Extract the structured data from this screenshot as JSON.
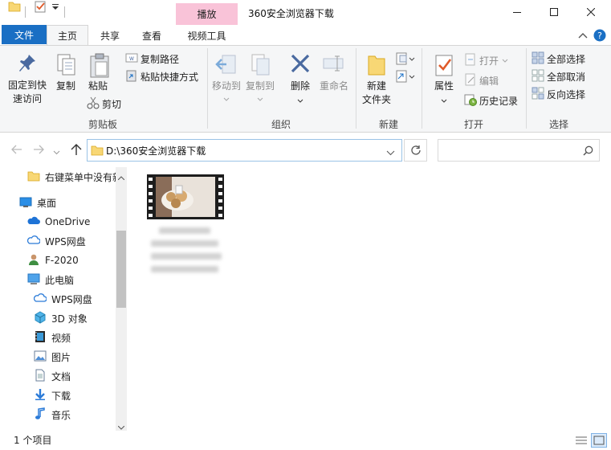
{
  "titlebar": {
    "context_tab": "播放",
    "title": "360安全浏览器下载"
  },
  "tabs": {
    "file": "文件",
    "home": "主页",
    "share": "共享",
    "view": "查看",
    "video_tools": "视频工具"
  },
  "ribbon": {
    "clipboard": {
      "group": "剪贴板",
      "pin": "固定到快速访问",
      "pin_line1": "固定到快",
      "pin_line2": "速访问",
      "copy": "复制",
      "paste": "粘贴",
      "copy_path": "复制路径",
      "paste_shortcut": "粘贴快捷方式",
      "cut": "剪切"
    },
    "organize": {
      "group": "组织",
      "move_to": "移动到",
      "copy_to": "复制到",
      "delete": "删除",
      "rename": "重命名"
    },
    "new": {
      "group": "新建",
      "new_folder_line1": "新建",
      "new_folder_line2": "文件夹"
    },
    "open": {
      "group": "打开",
      "properties": "属性",
      "open": "打开",
      "edit": "编辑",
      "history": "历史记录"
    },
    "select": {
      "group": "选择",
      "select_all": "全部选择",
      "select_none": "全部取消",
      "invert": "反向选择"
    }
  },
  "address": {
    "path": "D:\\360安全浏览器下载",
    "search_placeholder": ""
  },
  "nav": {
    "items": [
      {
        "label": "右键菜单中没有新",
        "icon": "folder-icon"
      },
      {
        "label": "桌面",
        "icon": "desktop-icon"
      },
      {
        "label": "OneDrive",
        "icon": "onedrive-icon"
      },
      {
        "label": "WPS网盘",
        "icon": "cloud-icon"
      },
      {
        "label": "F-2020",
        "icon": "user-icon"
      },
      {
        "label": "此电脑",
        "icon": "computer-icon"
      },
      {
        "label": "WPS网盘",
        "icon": "cloud-icon"
      },
      {
        "label": "3D 对象",
        "icon": "3d-objects-icon"
      },
      {
        "label": "视频",
        "icon": "videos-icon"
      },
      {
        "label": "图片",
        "icon": "pictures-icon"
      },
      {
        "label": "文档",
        "icon": "documents-icon"
      },
      {
        "label": "下载",
        "icon": "downloads-icon"
      },
      {
        "label": "音乐",
        "icon": "music-icon"
      }
    ]
  },
  "status": {
    "count": "1 个项目"
  },
  "colors": {
    "file_tab": "#1a6fc4",
    "context_tab": "#f9c3d8",
    "folder": "#f8d775",
    "accent": "#1a6fc4"
  }
}
